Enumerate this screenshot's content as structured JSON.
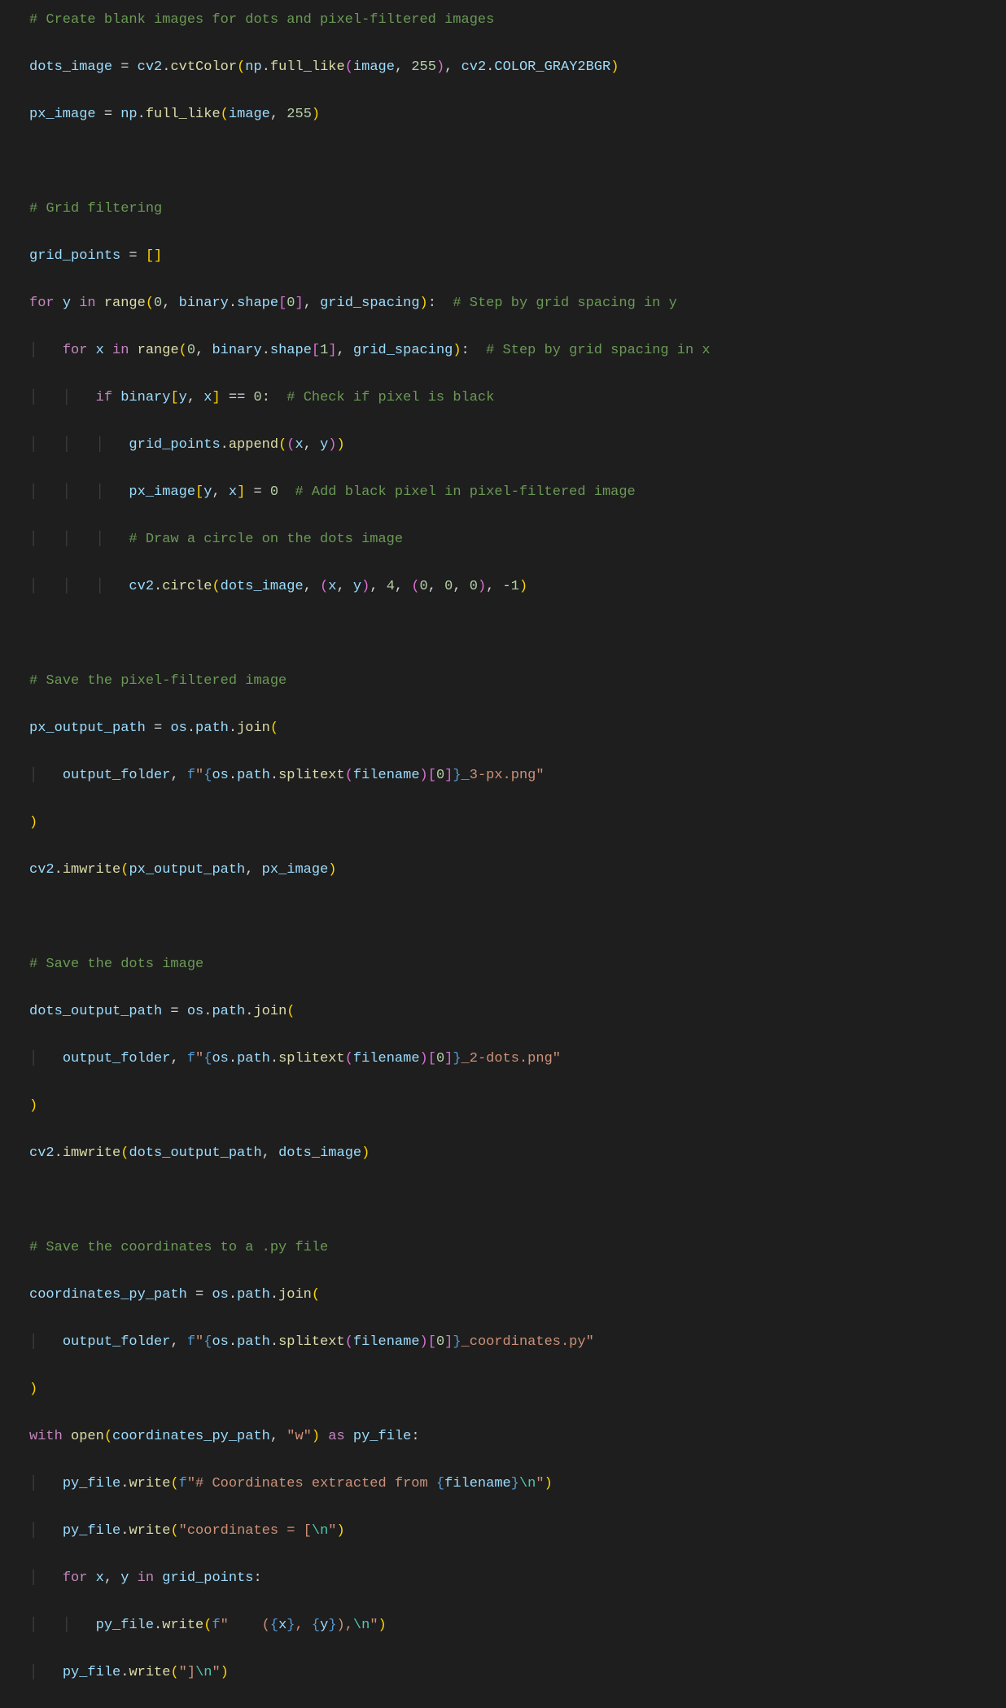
{
  "lines": {
    "l1": {
      "cm": "# Create blank images for dots and pixel-filtered images"
    },
    "l2": {
      "a": "dots_image",
      "b": "cv2",
      "c": "cvtColor",
      "d": "np",
      "e": "full_like",
      "f": "image",
      "g": "255",
      "h": "cv2",
      "i": "COLOR_GRAY2BGR"
    },
    "l3": {
      "a": "px_image",
      "b": "np",
      "c": "full_like",
      "d": "image",
      "e": "255"
    },
    "l5": {
      "cm": "# Grid filtering"
    },
    "l6": {
      "a": "grid_points"
    },
    "l7": {
      "a": "for",
      "b": "y",
      "c": "in",
      "d": "range",
      "e": "0",
      "f": "binary",
      "g": "shape",
      "h": "0",
      "i": "grid_spacing",
      "cm": "# Step by grid spacing in y"
    },
    "l8": {
      "a": "for",
      "b": "x",
      "c": "in",
      "d": "range",
      "e": "0",
      "f": "binary",
      "g": "shape",
      "h": "1",
      "i": "grid_spacing",
      "cm": "# Step by grid spacing in x"
    },
    "l9": {
      "a": "if",
      "b": "binary",
      "c": "y",
      "d": "x",
      "e": "0",
      "cm": "# Check if pixel is black"
    },
    "l10": {
      "a": "grid_points",
      "b": "append",
      "c": "x",
      "d": "y"
    },
    "l11": {
      "a": "px_image",
      "b": "y",
      "c": "x",
      "d": "0",
      "cm": "# Add black pixel in pixel-filtered image"
    },
    "l12": {
      "cm": "# Draw a circle on the dots image"
    },
    "l13": {
      "a": "cv2",
      "b": "circle",
      "c": "dots_image",
      "d": "x",
      "e": "y",
      "f": "4",
      "g": "0",
      "h": "0",
      "i": "0",
      "j": "1"
    },
    "l15": {
      "cm": "# Save the pixel-filtered image"
    },
    "l16": {
      "a": "px_output_path",
      "b": "os",
      "c": "path",
      "d": "join"
    },
    "l17": {
      "a": "output_folder",
      "b": "f",
      "c": "\"",
      "d": "os",
      "e": "path",
      "f": "splitext",
      "g": "filename",
      "h": "0",
      "i": "_3-px.png\""
    },
    "l19": {
      "a": "cv2",
      "b": "imwrite",
      "c": "px_output_path",
      "d": "px_image"
    },
    "l21": {
      "cm": "# Save the dots image"
    },
    "l22": {
      "a": "dots_output_path",
      "b": "os",
      "c": "path",
      "d": "join"
    },
    "l23": {
      "a": "output_folder",
      "b": "f",
      "c": "\"",
      "d": "os",
      "e": "path",
      "f": "splitext",
      "g": "filename",
      "h": "0",
      "i": "_2-dots.png\""
    },
    "l25": {
      "a": "cv2",
      "b": "imwrite",
      "c": "dots_output_path",
      "d": "dots_image"
    },
    "l27": {
      "cm": "# Save the coordinates to a .py file"
    },
    "l28": {
      "a": "coordinates_py_path",
      "b": "os",
      "c": "path",
      "d": "join"
    },
    "l29": {
      "a": "output_folder",
      "b": "f",
      "c": "\"",
      "d": "os",
      "e": "path",
      "f": "splitext",
      "g": "filename",
      "h": "0",
      "i": "_coordinates.py\""
    },
    "l31": {
      "a": "with",
      "b": "open",
      "c": "coordinates_py_path",
      "d": "\"w\"",
      "e": "as",
      "f": "py_file"
    },
    "l32": {
      "a": "py_file",
      "b": "write",
      "c": "f",
      "d": "\"# Coordinates extracted from ",
      "e": "filename",
      "f": "\\n",
      "g": "\""
    },
    "l33": {
      "a": "py_file",
      "b": "write",
      "c": "\"coordinates = [",
      "d": "\\n",
      "e": "\""
    },
    "l34": {
      "a": "for",
      "b": "x",
      "c": "y",
      "d": "in",
      "e": "grid_points"
    },
    "l35": {
      "a": "py_file",
      "b": "write",
      "c": "f",
      "d": "\"    (",
      "e": "x",
      "f": ", ",
      "g": "y",
      "h": "),",
      "i": "\\n",
      "j": "\""
    },
    "l36": {
      "a": "py_file",
      "b": "write",
      "c": "\"]",
      "d": "\\n",
      "e": "\""
    }
  }
}
